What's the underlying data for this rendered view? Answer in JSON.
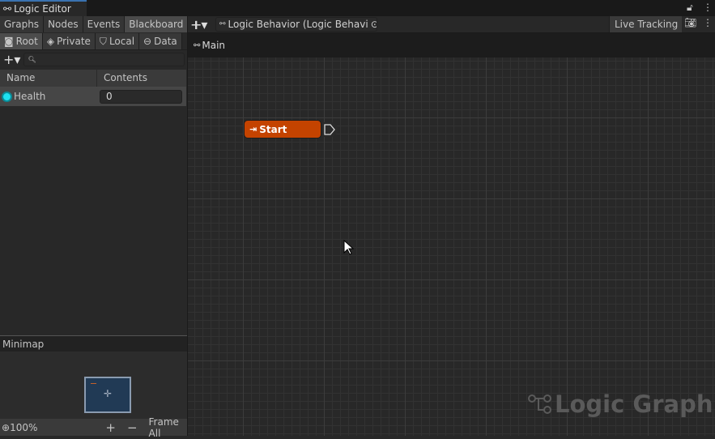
{
  "window": {
    "title": "Logic Editor"
  },
  "left_tabs": [
    "Graphs",
    "Nodes",
    "Events",
    "Blackboard"
  ],
  "scope_tabs": [
    "Root",
    "Private",
    "Local",
    "Data"
  ],
  "table": {
    "headers": [
      "Name",
      "Contents"
    ],
    "rows": [
      {
        "name": "Health",
        "value": "0"
      }
    ]
  },
  "minimap": {
    "title": "Minimap"
  },
  "footer": {
    "zoom": "100%",
    "zoom_in": "+",
    "zoom_out": "−",
    "frame_all": "Frame All"
  },
  "toolbar": {
    "add": "+",
    "object_field": "Logic Behavior (Logic Behavi",
    "live_tracking": "Live Tracking"
  },
  "breadcrumb": "Main",
  "node": {
    "title": "Start",
    "color": "#c44300"
  },
  "watermark": "Logic Graph"
}
